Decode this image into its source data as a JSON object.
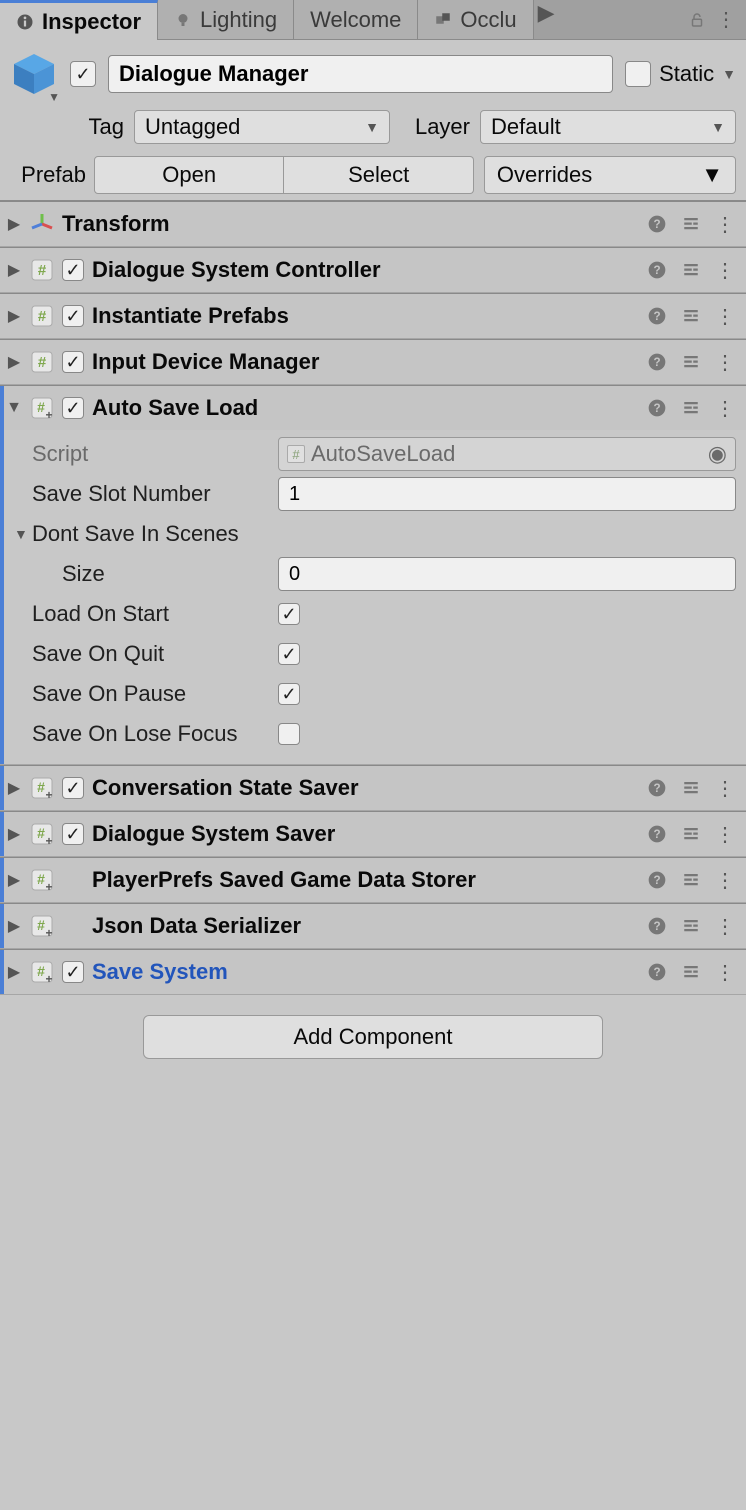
{
  "tabs": {
    "inspector": "Inspector",
    "lighting": "Lighting",
    "welcome": "Welcome",
    "occlusion": "Occlu"
  },
  "header": {
    "name": "Dialogue Manager",
    "static_label": "Static",
    "tag_label": "Tag",
    "tag_value": "Untagged",
    "layer_label": "Layer",
    "layer_value": "Default",
    "prefab_label": "Prefab",
    "open": "Open",
    "select": "Select",
    "overrides": "Overrides"
  },
  "components": [
    {
      "title": "Transform"
    },
    {
      "title": "Dialogue System Controller"
    },
    {
      "title": "Instantiate Prefabs"
    },
    {
      "title": "Input Device Manager"
    },
    {
      "title": "Auto Save Load"
    },
    {
      "title": "Conversation State Saver"
    },
    {
      "title": "Dialogue System Saver"
    },
    {
      "title": "PlayerPrefs Saved Game Data Storer"
    },
    {
      "title": "Json Data Serializer"
    },
    {
      "title": "Save System"
    }
  ],
  "auto_save_load": {
    "script_label": "Script",
    "script_value": "AutoSaveLoad",
    "save_slot_label": "Save Slot Number",
    "save_slot_value": "1",
    "dont_save_label": "Dont Save In Scenes",
    "size_label": "Size",
    "size_value": "0",
    "load_on_start_label": "Load On Start",
    "load_on_start": true,
    "save_on_quit_label": "Save On Quit",
    "save_on_quit": true,
    "save_on_pause_label": "Save On Pause",
    "save_on_pause": true,
    "save_on_lose_focus_label": "Save On Lose Focus",
    "save_on_lose_focus": false
  },
  "add_component": "Add Component"
}
